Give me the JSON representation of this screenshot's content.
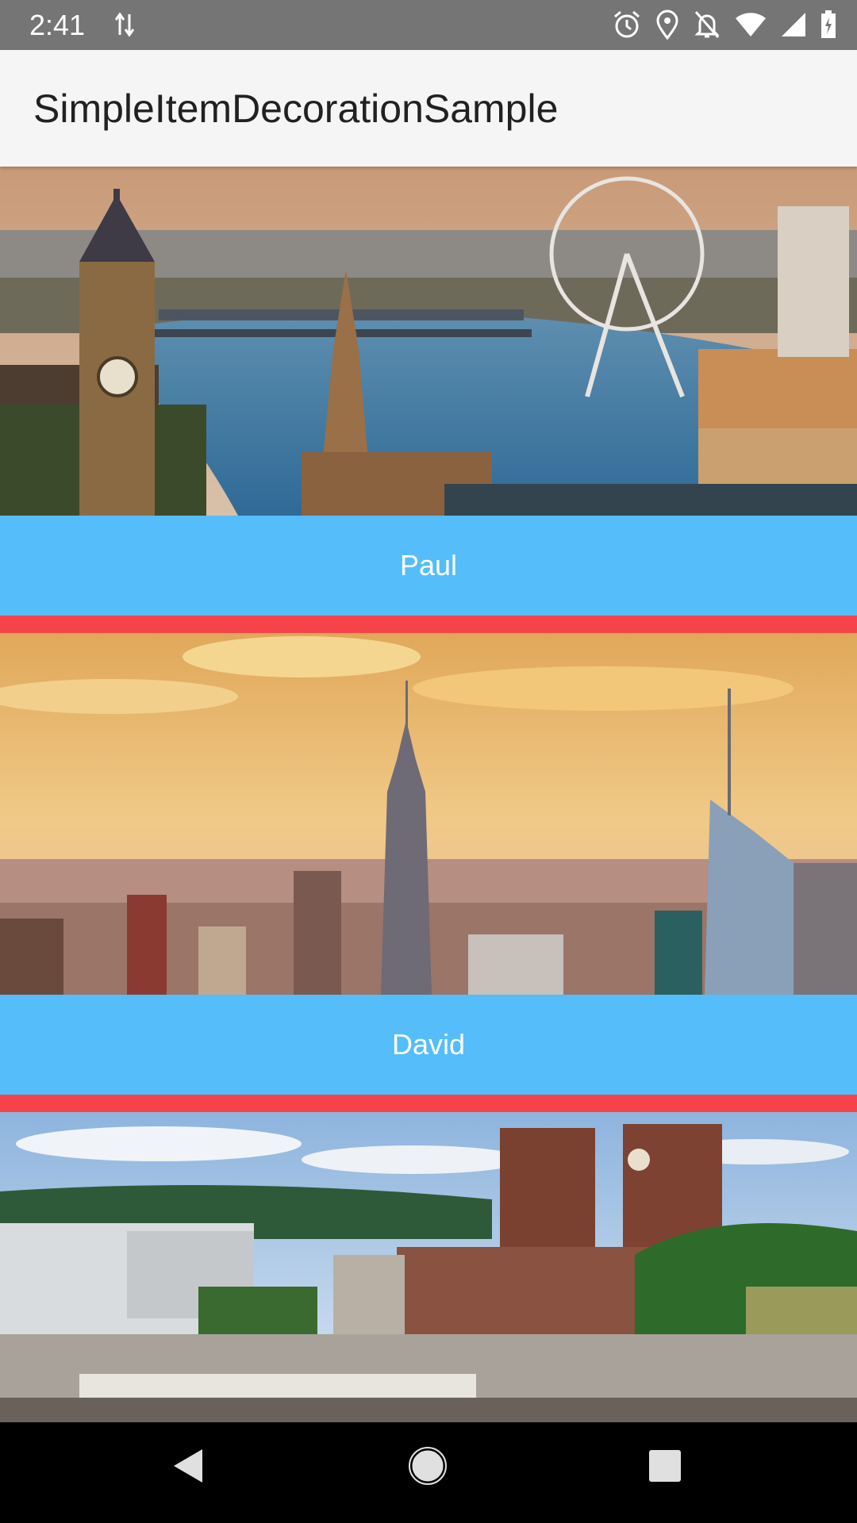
{
  "status_bar": {
    "time": "2:41",
    "icons": [
      "data-transfer-icon",
      "alarm-icon",
      "location-icon",
      "notifications-off-icon",
      "wifi-icon",
      "signal-icon",
      "battery-icon"
    ]
  },
  "app_bar": {
    "title": "SimpleItemDecorationSample"
  },
  "list": {
    "items": [
      {
        "label": "Paul",
        "image": "london-skyline-image"
      },
      {
        "label": "David",
        "image": "new-york-skyline-image"
      },
      {
        "label": "",
        "image": "oslo-city-hall-image"
      }
    ]
  },
  "colors": {
    "status_bar": "#757575",
    "app_bar": "#f5f5f5",
    "item_label_bg": "#54bdfa",
    "divider": "#f6434a",
    "nav_bar": "#000000"
  },
  "nav_bar": {
    "buttons": [
      "back-icon",
      "home-icon",
      "recents-icon"
    ]
  }
}
